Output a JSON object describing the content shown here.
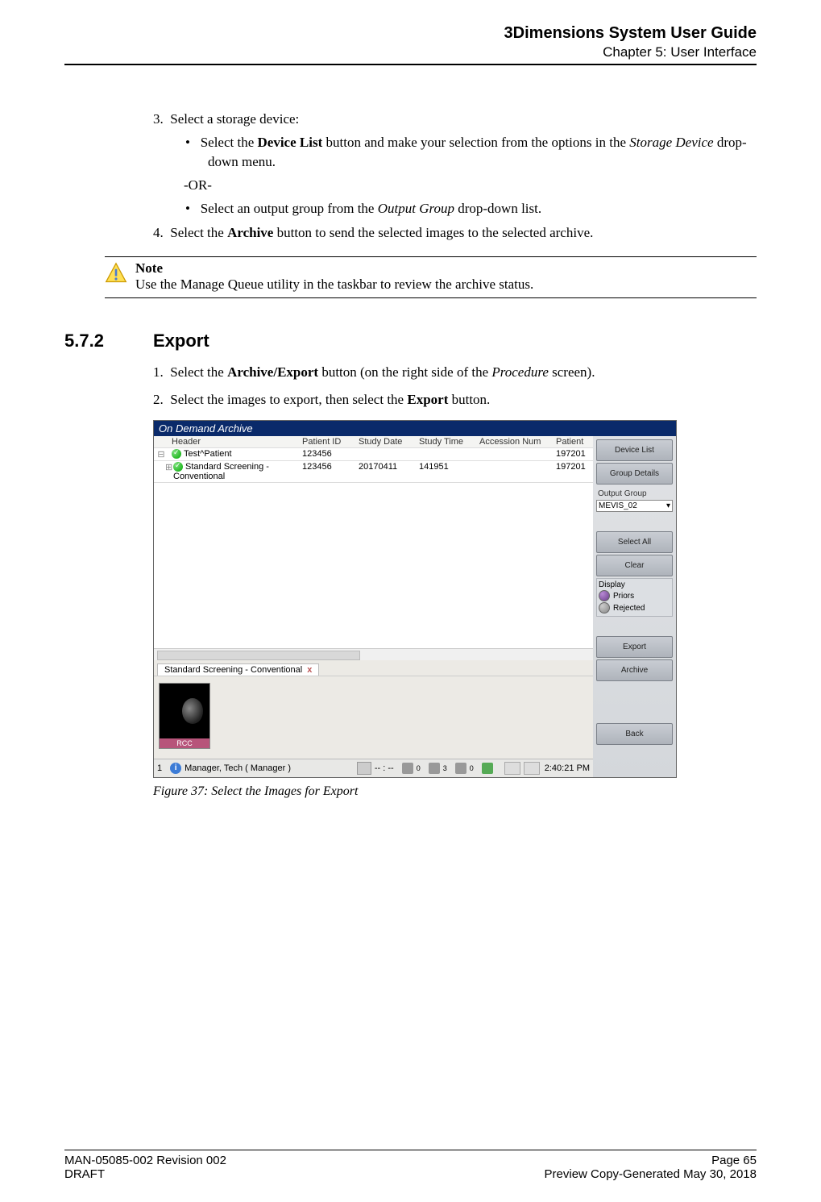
{
  "header": {
    "title": "3Dimensions System User Guide",
    "subtitle": "Chapter 5: User Interface"
  },
  "content": {
    "step3_num": "3.",
    "step3_text": "Select a storage device:",
    "bullet1_pre": "Select the ",
    "bullet1_bold": "Device List",
    "bullet1_mid": " button and make your selection from the options in the ",
    "bullet1_ital": "Storage Device",
    "bullet1_post": " drop-down menu.",
    "or": "-OR-",
    "bullet2_pre": "Select an output group from the ",
    "bullet2_ital": "Output Group",
    "bullet2_post": " drop-down list.",
    "step4_num": "4.",
    "step4_pre": "Select the ",
    "step4_bold": "Archive",
    "step4_post": " button to send the selected images to the selected archive."
  },
  "note": {
    "label": "Note",
    "text": "Use the Manage Queue utility in the taskbar to review the archive status."
  },
  "section": {
    "num": "5.7.2",
    "title": "Export",
    "p1_num": "1.",
    "p1_pre": "Select the ",
    "p1_bold": "Archive/Export",
    "p1_mid": " button (on the right side of the ",
    "p1_ital": "Procedure",
    "p1_post": " screen).",
    "p2_num": "2.",
    "p2_pre": "Select the images to export, then select the ",
    "p2_bold": "Export",
    "p2_post": " button."
  },
  "fig": {
    "title": "On Demand Archive",
    "cols": {
      "header": "Header",
      "pid": "Patient ID",
      "sd": "Study Date",
      "st": "Study Time",
      "an": "Accession Num",
      "pat": "Patient"
    },
    "row1": {
      "header": "Test^Patient",
      "pid": "123456",
      "pat": "197201"
    },
    "row2": {
      "header": "Standard Screening - Conventional",
      "pid": "123456",
      "sd": "20170411",
      "st": "141951",
      "pat": "197201"
    },
    "tab_label": "Standard Screening - Conventional",
    "tab_close": "x",
    "thumb_label": "RCC",
    "status": {
      "n1": "1",
      "user": "Manager, Tech ( Manager )",
      "timecard": "-- : --",
      "z0a": "0",
      "z0b": "3",
      "z0c": "0",
      "clock": "2:40:21 PM"
    },
    "side": {
      "device_list": "Device List",
      "group_details": "Group Details",
      "output_group": "Output Group",
      "select_value": "MEVIS_02",
      "select_all": "Select All",
      "clear": "Clear",
      "display": "Display",
      "priors": "Priors",
      "rejected": "Rejected",
      "export": "Export",
      "archive": "Archive",
      "back": "Back"
    },
    "caption": "Figure 37: Select the Images for Export"
  },
  "footer": {
    "left1": "MAN-05085-002 Revision 002",
    "left2": "DRAFT",
    "right1": "Page 65",
    "right2": "Preview Copy-Generated May 30, 2018"
  }
}
